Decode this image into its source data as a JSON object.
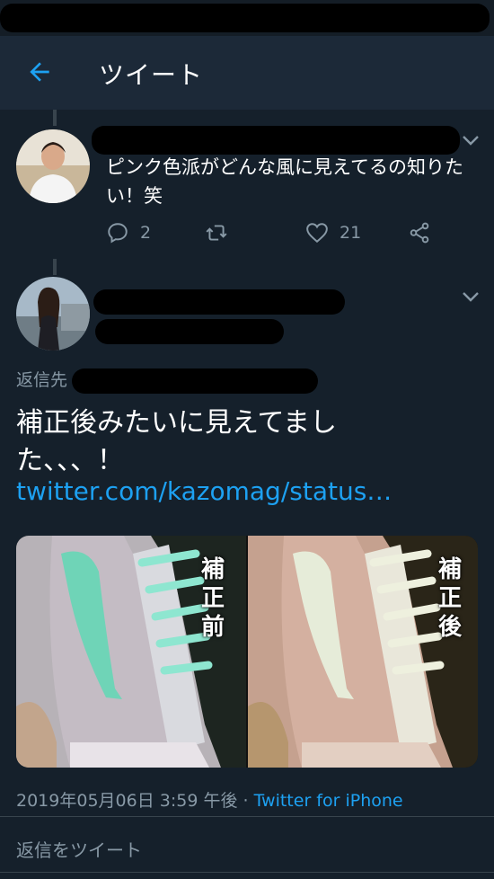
{
  "header": {
    "title": "ツイート",
    "back_icon": "arrow-left-icon"
  },
  "reply_tweet": {
    "text": "ピンク色派がどんな風に見えてるの知りたい！笑",
    "replies": "2",
    "retweets": "",
    "likes": "21"
  },
  "main_tweet": {
    "reply_to_label": "返信先",
    "text_line1": "補正後みたいに見えてまし",
    "text_line2": "た、、、！",
    "link": "twitter.com/kazomag/status…",
    "media": {
      "left_label": "補正前",
      "right_label": "補正後"
    },
    "date": "2019年05月06日 3:59 午後",
    "separator": " · ",
    "via": "Twitter for iPhone"
  },
  "compose": {
    "placeholder": "返信をツイート"
  },
  "colors": {
    "background": "#15202b",
    "header": "#1c2938",
    "accent": "#1da1f2",
    "muted": "#8899a6"
  }
}
